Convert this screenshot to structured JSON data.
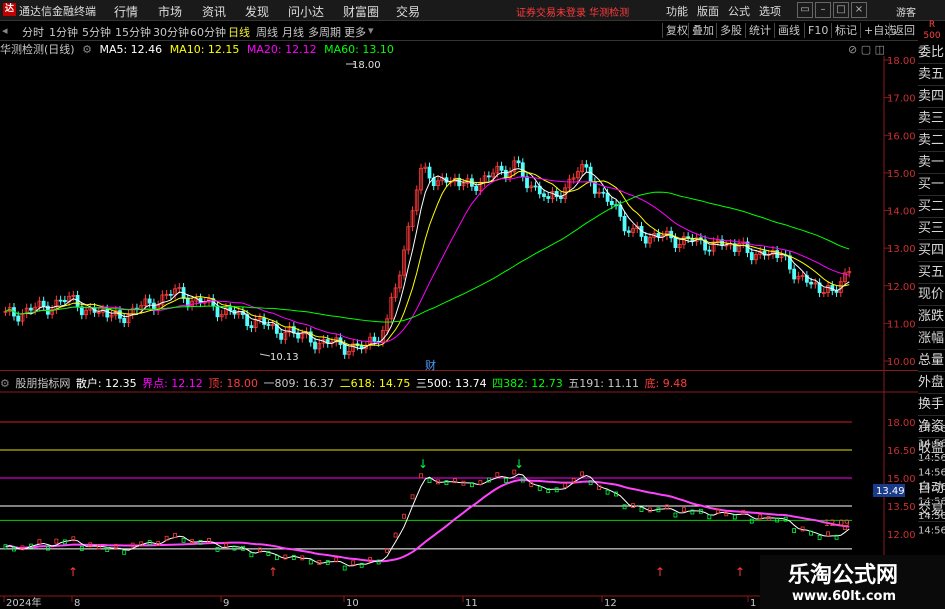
{
  "menubar": {
    "logo": "达",
    "title": "通达信金融终端",
    "items": [
      "行情",
      "市场",
      "资讯",
      "发现",
      "问小达",
      "财富圈",
      "交易"
    ],
    "login_warn": "证券交易未登录  华测检测",
    "right": [
      "功能",
      "版面",
      "公式",
      "选项"
    ],
    "guest": "游客",
    "r_badge": "R 500"
  },
  "period_bar": {
    "periods": [
      "分时",
      "1分钟",
      "5分钟",
      "15分钟",
      "30分钟",
      "60分钟",
      "日线",
      "周线",
      "月线",
      "多周期",
      "更多"
    ],
    "active": "日线",
    "tools": [
      "复权",
      "叠加",
      "多股",
      "统计",
      "画线",
      "F10",
      "标记",
      "+自选",
      "返回"
    ]
  },
  "info": {
    "stock": "华测检测(日线)",
    "ma5": "MA5: 12.46",
    "ma10": "MA10: 12.15",
    "ma20": "MA20: 12.12",
    "ma60": "MA60: 13.10"
  },
  "indicator": {
    "name": "股朋指标网",
    "san": "散户: 12.35",
    "jie": "界点: 12.12",
    "ding": "顶: 18.00",
    "l809": "一809: 16.37",
    "l618": "二618: 14.75",
    "l500": "三500: 13.74",
    "l382": "四382: 12.73",
    "l191": "五191: 11.11",
    "di": "底: 9.48"
  },
  "side": [
    "委比",
    "卖五",
    "卖四",
    "卖三",
    "卖二",
    "卖一",
    "买一",
    "买二",
    "买三",
    "买四",
    "买五",
    "现价",
    "涨跌",
    "涨幅",
    "总量",
    "外盘",
    "换手",
    "净资",
    "收益",
    "自动",
    "交易"
  ],
  "price_axis": [
    "18.00",
    "17.00",
    "16.00",
    "15.00",
    "14.00",
    "13.00",
    "12.00",
    "11.00",
    "10.00"
  ],
  "ind_axis": [
    "18.00",
    "16.50",
    "15.00",
    "13.50",
    "12.00"
  ],
  "ind_axis_partial": [
    "14:56",
    "14:56",
    "14:56",
    "14:56",
    "14:56",
    "14:56",
    "14:56",
    "14:56"
  ],
  "highlight_price": "13.49",
  "chart_labels": {
    "high": "18.00",
    "low": "10.13",
    "cai": "财",
    "last": "12.09"
  },
  "date_axis": [
    "2024年",
    "8",
    "9",
    "10",
    "11",
    "12",
    "1"
  ],
  "watermark": {
    "title": "乐淘公式网",
    "url": "www.60lt.com"
  },
  "colors": {
    "up": "#ff3b3b",
    "down": "#54fcfc",
    "ma5": "#ffffff",
    "ma10": "#ffff00",
    "ma20": "#ff00ff",
    "ma60": "#00ff00"
  }
}
